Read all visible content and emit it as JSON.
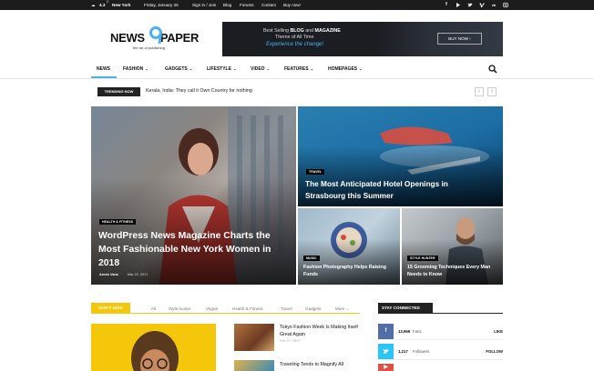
{
  "topbar": {
    "weather_temp": "4.3",
    "weather_unit": "C",
    "city": "New York",
    "date": "Friday, January 25",
    "links": [
      "Sign in / Join",
      "Blog",
      "Forums",
      "Contact",
      "Buy now!"
    ],
    "social": [
      "f",
      "▶",
      "t",
      "▶",
      "vk",
      "◉"
    ]
  },
  "logo": {
    "text_left": "NEWS",
    "text_right": "PAPER",
    "digit": "9",
    "tagline": "the art of publishing"
  },
  "banner": {
    "line1_pre": "Best Selling ",
    "line1_b1": "BLOG",
    "line1_mid": " and ",
    "line1_b2": "MAGAZINE",
    "line2": "Theme of All Time",
    "line3": "Experience the change!",
    "button": "BUY NOW ›"
  },
  "nav": {
    "items": [
      "NEWS",
      "FASHION",
      "GADGETS",
      "LIFESTYLE",
      "VIDEO",
      "FEATURES",
      "HOMEPAGES"
    ],
    "caret": "⌄"
  },
  "trending": {
    "badge": "TRENDING NOW",
    "headline": "Kerala, India: They call it Own Country for nothing",
    "prev": "‹",
    "next": "›"
  },
  "featured": {
    "main": {
      "category": "HEALTH & FITNESS",
      "title": "WordPress News Magazine Charts the Most Fashionable New York Women in 2018",
      "author": "Armin Vans",
      "date": "Mar 22, 2017"
    },
    "top_right": {
      "category": "TRAVEL",
      "title": "The Most Anticipated Hotel Openings in Strasbourg this Summer"
    },
    "bottom_left": {
      "category": "MUSIC",
      "title": "Fashion Photography Helps Raising Funds"
    },
    "bottom_right": {
      "category": "STYLE HUNTER",
      "title": "15 Grooming Techniques Every Man Needs to Know"
    }
  },
  "dont_miss": {
    "badge": "DON'T MISS",
    "tabs": [
      "All",
      "Style hunter",
      "Vogue",
      "Health & Fitness",
      "Travel",
      "Gadgets",
      "More"
    ],
    "items": [
      {
        "title": "Tokyo Fashion Week Is Making Itself Great Again",
        "date": "Feb 27, 2017"
      },
      {
        "title": "Traveling Tends to Magnify All",
        "date": ""
      }
    ]
  },
  "stay_connected": {
    "badge": "STAY CONNECTED",
    "rows": [
      {
        "icon": "f",
        "count": "13,969",
        "label": "Fans",
        "action": "LIKE",
        "color": "#516eab"
      },
      {
        "icon": "t",
        "count": "1,217",
        "label": "Followers",
        "action": "FOLLOW",
        "color": "#29c5f6"
      },
      {
        "icon": "▶",
        "count": "",
        "label": "",
        "action": "",
        "color": "#e14e42"
      }
    ]
  }
}
